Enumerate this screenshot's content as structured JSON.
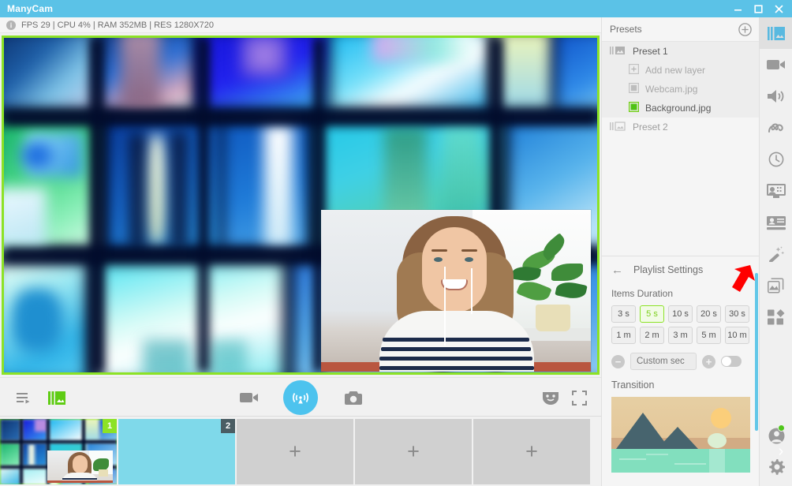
{
  "window": {
    "title": "ManyCam",
    "controls": [
      {
        "name": "minimize-button",
        "glyph": "minimize"
      },
      {
        "name": "maximize-button",
        "glyph": "maximize"
      },
      {
        "name": "close-button",
        "glyph": "close"
      }
    ],
    "accent_color": "#5bc2e7"
  },
  "statusbar": {
    "info_icon": "i",
    "text": "FPS 29 | CPU 4% | RAM 352MB | RES 1280X720",
    "fps": "29",
    "cpu": "4%",
    "ram": "352MB",
    "resolution": "1280X720"
  },
  "preview": {
    "border_color": "#8ce226",
    "background_layer_name": "Background.jpg",
    "webcam_layer_name": "Webcam.jpg"
  },
  "controlbar": {
    "buttons": [
      {
        "name": "playlist-button",
        "icon": "playlist-icon",
        "label": "Playlist"
      },
      {
        "name": "presets-view-button",
        "icon": "presets-icon",
        "label": "Presets",
        "color": "#5fcc14"
      },
      {
        "name": "record-button",
        "icon": "video-camera-icon",
        "label": "Record"
      },
      {
        "name": "broadcast-button",
        "icon": "broadcast-icon",
        "label": "Broadcast",
        "color": "#4dc3ee"
      },
      {
        "name": "snapshot-button",
        "icon": "camera-icon",
        "label": "Snapshot"
      },
      {
        "name": "effects-button",
        "icon": "mask-icon",
        "label": "Effects"
      },
      {
        "name": "fullscreen-button",
        "icon": "fullscreen-icon",
        "label": "Fullscreen"
      }
    ]
  },
  "thumbnails": {
    "items": [
      {
        "name": "thumbnail-1",
        "badge": "1",
        "state": "active",
        "kind": "videowall"
      },
      {
        "name": "thumbnail-2",
        "badge": "2",
        "state": "selected",
        "kind": "blank-cyan"
      },
      {
        "name": "thumbnail-3",
        "badge": "",
        "state": "empty",
        "kind": "add"
      },
      {
        "name": "thumbnail-4",
        "badge": "",
        "state": "empty",
        "kind": "add"
      },
      {
        "name": "thumbnail-5",
        "badge": "",
        "state": "empty",
        "kind": "add"
      }
    ],
    "add_glyph": "+",
    "next_glyph": "›"
  },
  "presets_panel": {
    "title": "Presets",
    "add_button_label": "+",
    "rows": [
      {
        "name": "preset-1",
        "label": "Preset 1",
        "type": "preset",
        "selected": true
      },
      {
        "name": "add-new-layer",
        "label": "Add new layer",
        "type": "add-layer",
        "dim": true
      },
      {
        "name": "layer-webcam",
        "label": "Webcam.jpg",
        "type": "layer",
        "dim": true,
        "active": false
      },
      {
        "name": "layer-background",
        "label": "Background.jpg",
        "type": "layer",
        "dim": false,
        "active": true
      },
      {
        "name": "preset-2",
        "label": "Preset 2",
        "type": "preset",
        "selected": false
      }
    ]
  },
  "playlist_settings": {
    "back_glyph": "←",
    "title": "Playlist Settings",
    "items_duration_label": "Items Duration",
    "durations_row1": [
      {
        "label": "3 s",
        "selected": false
      },
      {
        "label": "5 s",
        "selected": true
      },
      {
        "label": "10 s",
        "selected": false
      },
      {
        "label": "20 s",
        "selected": false
      },
      {
        "label": "30 s",
        "selected": false
      }
    ],
    "durations_row2": [
      {
        "label": "1 m",
        "selected": false
      },
      {
        "label": "2 m",
        "selected": false
      },
      {
        "label": "3 m",
        "selected": false
      },
      {
        "label": "5 m",
        "selected": false
      },
      {
        "label": "10 m",
        "selected": false
      }
    ],
    "minus_glyph": "−",
    "plus_glyph": "+",
    "custom_placeholder": "Custom sec",
    "custom_value": "",
    "toggle_state": "off",
    "transition_label": "Transition",
    "selected_duration": "5 s",
    "selected_color": "#8ce226"
  },
  "rail": {
    "items": [
      {
        "name": "rail-presets",
        "icon": "presets-icon",
        "active": true
      },
      {
        "name": "rail-video-sources",
        "icon": "video-camera-icon",
        "active": false
      },
      {
        "name": "rail-audio",
        "icon": "speaker-icon",
        "active": false
      },
      {
        "name": "rail-draw",
        "icon": "scribble-icon",
        "active": false
      },
      {
        "name": "rail-history",
        "icon": "clock-icon",
        "active": false
      },
      {
        "name": "rail-lower-thirds",
        "icon": "monitor-people-icon",
        "active": false
      },
      {
        "name": "rail-titles",
        "icon": "id-card-icon",
        "active": false
      },
      {
        "name": "rail-effects",
        "icon": "magic-wand-icon",
        "active": false
      },
      {
        "name": "rail-backgrounds",
        "icon": "images-icon",
        "active": false
      },
      {
        "name": "rail-apps",
        "icon": "grid-shapes-icon",
        "active": false
      }
    ],
    "bottom_items": [
      {
        "name": "rail-account",
        "icon": "user-icon",
        "active": false,
        "badge": true
      },
      {
        "name": "rail-settings",
        "icon": "gear-icon",
        "active": false
      }
    ]
  },
  "annotation": {
    "arrow_color": "#ff0000",
    "name": "red-pointer-arrow"
  }
}
